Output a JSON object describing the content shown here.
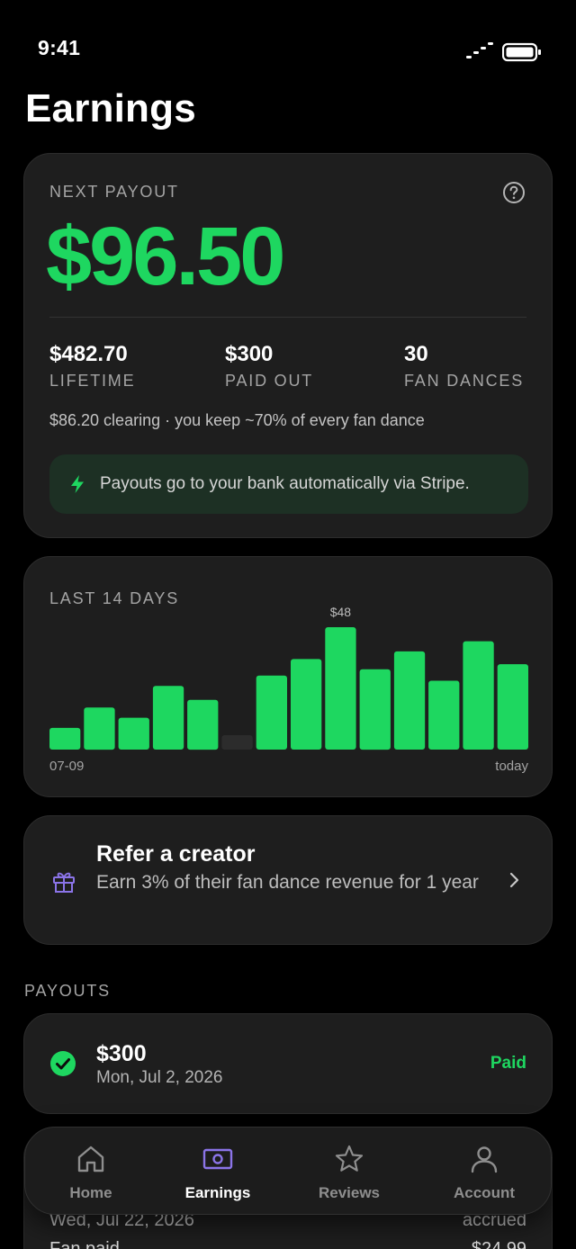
{
  "status_bar": {
    "time": "9:41"
  },
  "page_title": "Earnings",
  "payout_card": {
    "label": "NEXT PAYOUT",
    "amount": "$96.50",
    "stats": [
      {
        "value": "$482.70",
        "label": "LIFETIME"
      },
      {
        "value": "$300",
        "label": "PAID OUT"
      },
      {
        "value": "30",
        "label": "FAN DANCES"
      }
    ],
    "clearing_note": "$86.20 clearing · you keep ~70% of every fan dance",
    "stripe_note": "Payouts go to your bank automatically via Stripe."
  },
  "chart_data": {
    "type": "bar",
    "title": "LAST 14 DAYS",
    "x_start_label": "07-09",
    "x_end_label": "today",
    "peak_label": "$48",
    "values": [
      8.5,
      16.5,
      12.5,
      25,
      19.5,
      0,
      29,
      35.5,
      48,
      31.5,
      38.5,
      27,
      42.5,
      33.5
    ],
    "ylim": [
      0,
      48
    ],
    "bar_color": "#1ed760",
    "empty_bar_color": "#2c2c2c",
    "grid": false
  },
  "refer": {
    "title": "Refer a creator",
    "description": "Earn 3% of their fan dance revenue for 1 year"
  },
  "payouts_section": {
    "label": "PAYOUTS",
    "items": [
      {
        "amount": "$300",
        "date": "Mon, Jul 2, 2026",
        "status": "Paid"
      },
      {
        "date": "Wed, Jul 22, 2026",
        "status": "accrued",
        "type": "Fan paid",
        "amount": "$24.99"
      }
    ]
  },
  "tab_bar": {
    "items": [
      {
        "label": "Home",
        "icon": "home-icon"
      },
      {
        "label": "Earnings",
        "icon": "earnings-icon"
      },
      {
        "label": "Reviews",
        "icon": "star-icon"
      },
      {
        "label": "Account",
        "icon": "person-icon"
      }
    ],
    "active_color": "#8b74e8",
    "inactive_color": "#8e8e8e"
  },
  "colors": {
    "accent_green": "#1ed760",
    "accent_purple": "#8b74e8",
    "card_bg": "#1e1e1e"
  }
}
